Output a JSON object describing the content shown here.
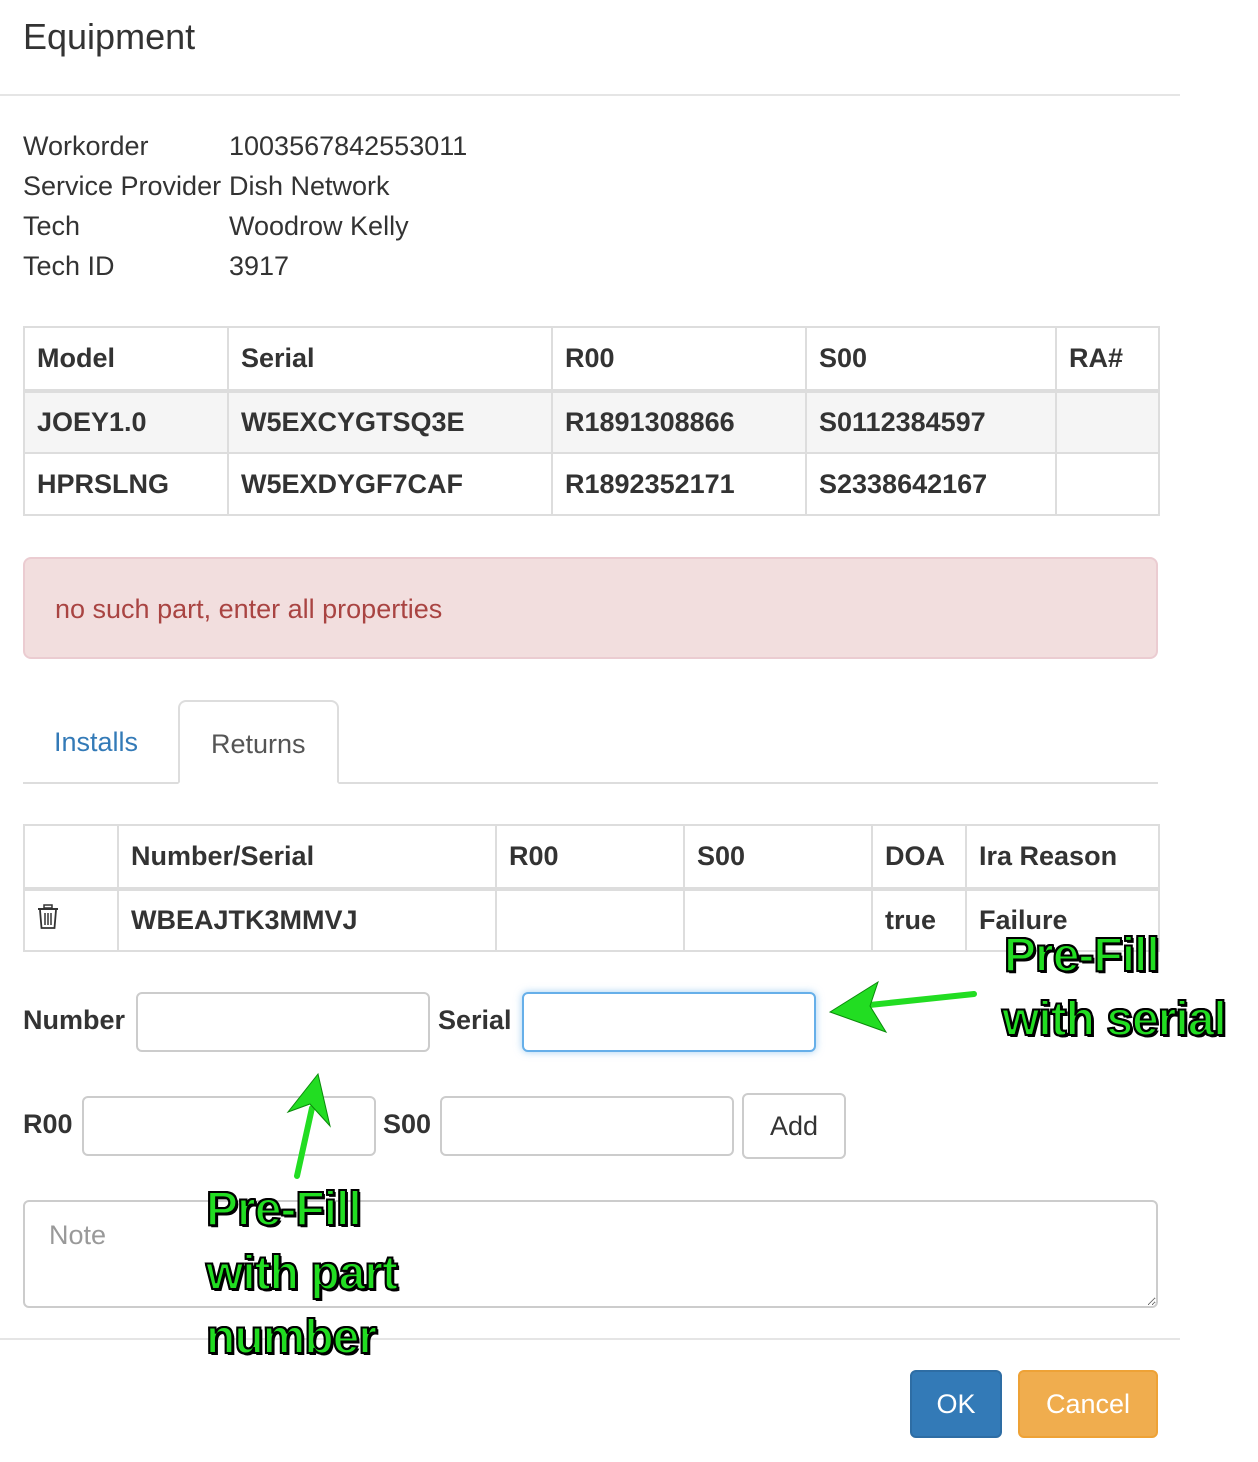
{
  "modal": {
    "title": "Equipment"
  },
  "info": [
    {
      "label": "Workorder",
      "value": "1003567842553011"
    },
    {
      "label": "Service Provider",
      "value": "Dish Network"
    },
    {
      "label": "Tech",
      "value": "Woodrow Kelly"
    },
    {
      "label": "Tech ID",
      "value": "3917"
    }
  ],
  "equipment_table": {
    "headers": [
      "Model",
      "Serial",
      "R00",
      "S00",
      "RA#"
    ],
    "rows": [
      [
        "JOEY1.0",
        "W5EXCYGTSQ3E",
        "R1891308866",
        "S0112384597",
        ""
      ],
      [
        "HPRSLNG",
        "W5EXDYGF7CAF",
        "R1892352171",
        "S2338642167",
        ""
      ]
    ]
  },
  "alert": {
    "text": "no such part, enter all properties"
  },
  "tabs": {
    "installs": "Installs",
    "returns": "Returns",
    "active": "Returns"
  },
  "returns_table": {
    "headers": [
      "",
      "Number/Serial",
      "R00",
      "S00",
      "DOA",
      "Ira Reason"
    ],
    "rows": [
      {
        "icon": "trash-icon",
        "number_serial": "WBEAJTK3MMVJ",
        "r00": "",
        "s00": "",
        "doa": "true",
        "reason": "Failure"
      }
    ]
  },
  "form": {
    "number_label": "Number",
    "number_value": "",
    "serial_label": "Serial",
    "serial_value": "",
    "r00_label": "R00",
    "r00_value": "",
    "s00_label": "S00",
    "s00_value": "",
    "add_label": "Add",
    "note_placeholder": "Note"
  },
  "footer": {
    "ok_label": "OK",
    "cancel_label": "Cancel"
  },
  "annotations": {
    "serial_line1": "Pre-Fill",
    "serial_line2": "with serial",
    "number_line1": "Pre-Fill",
    "number_line2": "with part",
    "number_line3": "number",
    "color": "#22dd22"
  },
  "colors": {
    "primary": "#337ab7",
    "warning": "#f0ad4e",
    "danger_bg": "#f2dede",
    "danger_text": "#a94442",
    "focus": "#66afe9"
  }
}
